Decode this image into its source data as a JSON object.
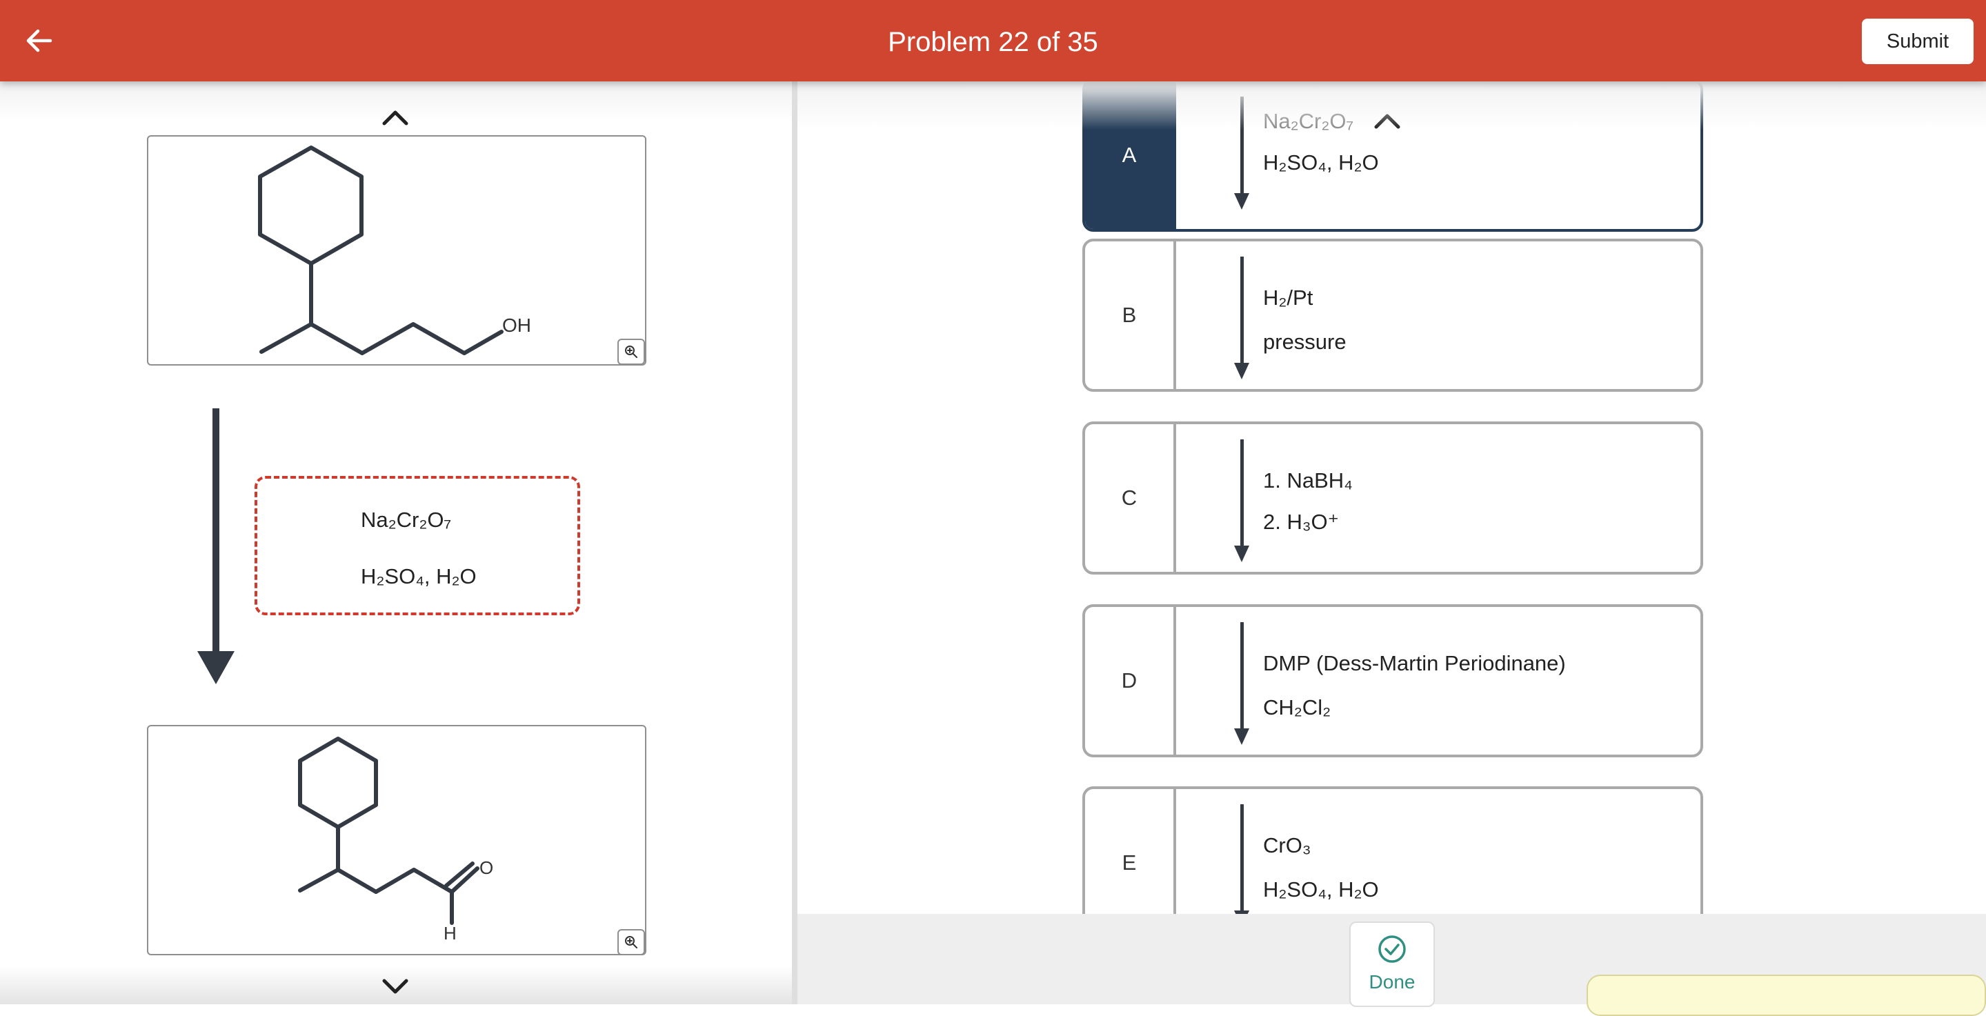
{
  "header": {
    "title": "Problem 22 of 35",
    "submit_label": "Submit",
    "color": "#cf4530"
  },
  "reaction": {
    "starting_material": {
      "label": "OH"
    },
    "product": {
      "label_o": "O",
      "label_h": "H"
    },
    "selected_reagent": {
      "line1": "Na₂Cr₂O₇",
      "line2": "H₂SO₄, H₂O"
    }
  },
  "options": [
    {
      "letter": "A",
      "line1": "Na₂Cr₂O₇",
      "line2": "H₂SO₄, H₂O",
      "selected": true
    },
    {
      "letter": "B",
      "line1": "H₂/Pt",
      "line2": "pressure",
      "selected": false
    },
    {
      "letter": "C",
      "line1": "1. NaBH₄",
      "line2": "2. H₃O⁺",
      "selected": false
    },
    {
      "letter": "D",
      "line1": "DMP (Dess-Martin Periodinane)",
      "line2": "CH₂Cl₂",
      "selected": false
    },
    {
      "letter": "E",
      "line1": "CrO₃",
      "line2": "H₂SO₄, H₂O",
      "selected": false
    }
  ],
  "footer": {
    "done_label": "Done",
    "accent": "#2f8f80"
  },
  "colors": {
    "selected": "#253d58",
    "dashed_border": "#d0392b"
  },
  "icons": [
    "back-arrow-icon",
    "chevron-up-icon",
    "chevron-down-icon",
    "zoom-in-icon",
    "check-circle-icon",
    "down-arrow-icon"
  ]
}
